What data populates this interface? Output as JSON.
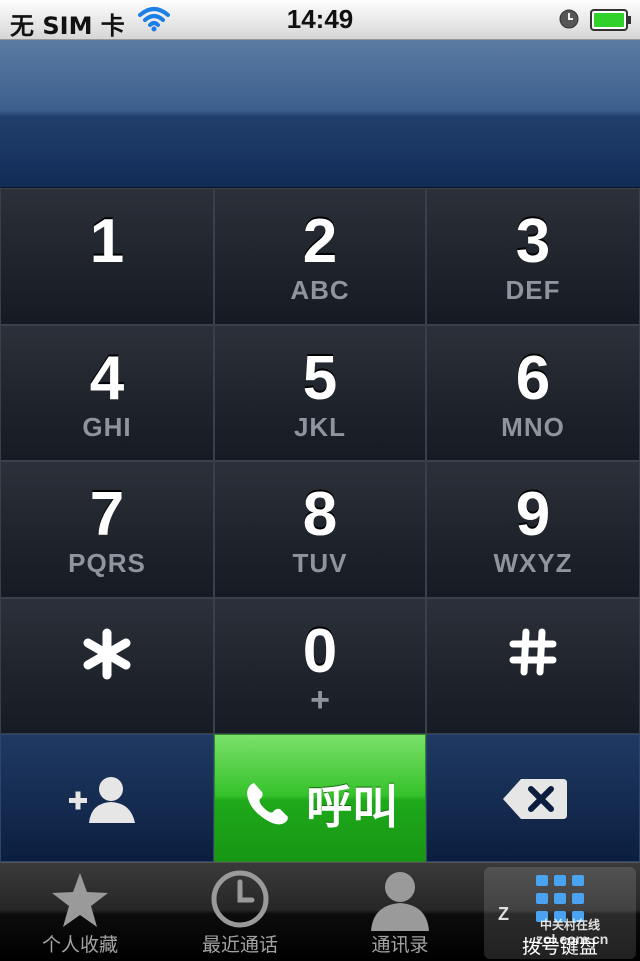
{
  "status_bar": {
    "carrier": "无 SIM 卡",
    "time": "14:49",
    "battery_color": "#2fd12a"
  },
  "keypad": {
    "keys": [
      {
        "digit": "1",
        "letters": ""
      },
      {
        "digit": "2",
        "letters": "ABC"
      },
      {
        "digit": "3",
        "letters": "DEF"
      },
      {
        "digit": "4",
        "letters": "GHI"
      },
      {
        "digit": "5",
        "letters": "JKL"
      },
      {
        "digit": "6",
        "letters": "MNO"
      },
      {
        "digit": "7",
        "letters": "PQRS"
      },
      {
        "digit": "8",
        "letters": "TUV"
      },
      {
        "digit": "9",
        "letters": "WXYZ"
      },
      {
        "digit": "*",
        "letters": ""
      },
      {
        "digit": "0",
        "letters": "+"
      },
      {
        "digit": "#",
        "letters": ""
      }
    ]
  },
  "actions": {
    "add_contact_icon": "add-contact-icon",
    "call_label": "呼叫",
    "call_color": "#2fbf27",
    "delete_icon": "backspace-icon"
  },
  "tabbar": {
    "tabs": [
      {
        "label": "个人收藏",
        "icon": "star-icon"
      },
      {
        "label": "最近通话",
        "icon": "clock-icon"
      },
      {
        "label": "通讯录",
        "icon": "person-icon"
      },
      {
        "label": "拨号键盘",
        "icon": "keypad-icon"
      }
    ],
    "active_tab": "拨号键盘"
  },
  "watermark": {
    "logo_letter": "Z",
    "brand": "中关村在线",
    "url": "zol.com.cn"
  }
}
